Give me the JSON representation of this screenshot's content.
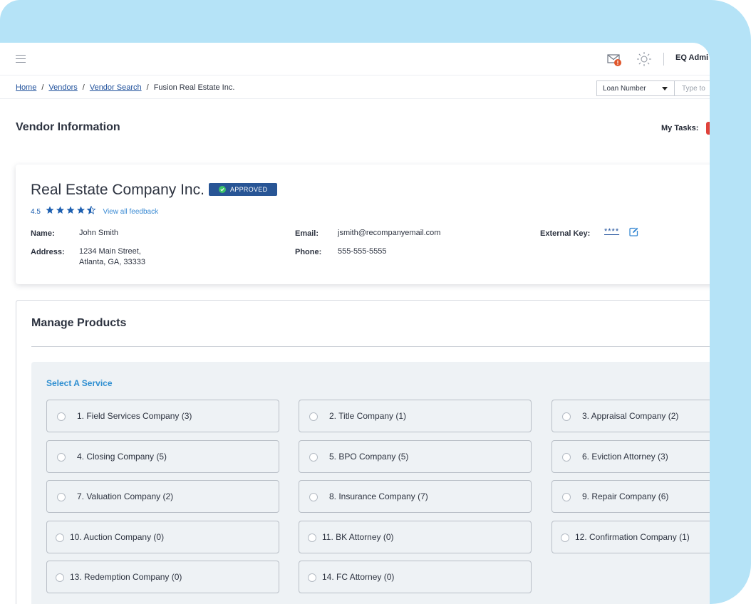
{
  "header": {
    "user_name": "EQ Admi",
    "icons": [
      "menu-icon",
      "mail-notification-icon",
      "theme-sun-icon"
    ],
    "accent_colors": {
      "primary": "#285595",
      "link": "#1d4f9b",
      "alert": "#e0413a",
      "success": "#3cc26a"
    }
  },
  "breadcrumb": {
    "items": [
      "Home",
      "Vendors",
      "Vendor Search"
    ],
    "separator": "/",
    "current": "Fusion Real Estate Inc."
  },
  "search": {
    "type_selected": "Loan Number",
    "placeholder": "Type to"
  },
  "page": {
    "title": "Vendor Information",
    "my_tasks_label": "My Tasks:"
  },
  "vendor": {
    "company_name": "Real Estate Company Inc.",
    "status": "APPROVED",
    "rating_value": "4.5",
    "rating_stars": 4.5,
    "feedback_link": "View all feedback",
    "name_label": "Name:",
    "name": "John Smith",
    "address_label": "Address:",
    "address_line1": "1234 Main Street,",
    "address_line2": "Atlanta, GA, 33333",
    "email_label": "Email:",
    "email": "jsmith@recompanyemail.com",
    "phone_label": "Phone:",
    "phone": "555-555-5555",
    "external_key_label": "External Key:",
    "external_key": "****"
  },
  "products": {
    "title": "Manage Products",
    "service_heading": "Select A Service",
    "services": [
      "1. Field Services Company (3)",
      "2. Title Company (1)",
      "3. Appraisal Company (2)",
      "4. Closing Company (5)",
      "5. BPO Company (5)",
      "6. Eviction Attorney (3)",
      "7. Valuation Company (2)",
      "8. Insurance Company (7)",
      "9. Repair Company (6)",
      "10. Auction Company (0)",
      "11. BK Attorney (0)",
      "12. Confirmation Company (1)",
      "13. Redemption Company (0)",
      "14. FC Attorney (0)"
    ]
  }
}
